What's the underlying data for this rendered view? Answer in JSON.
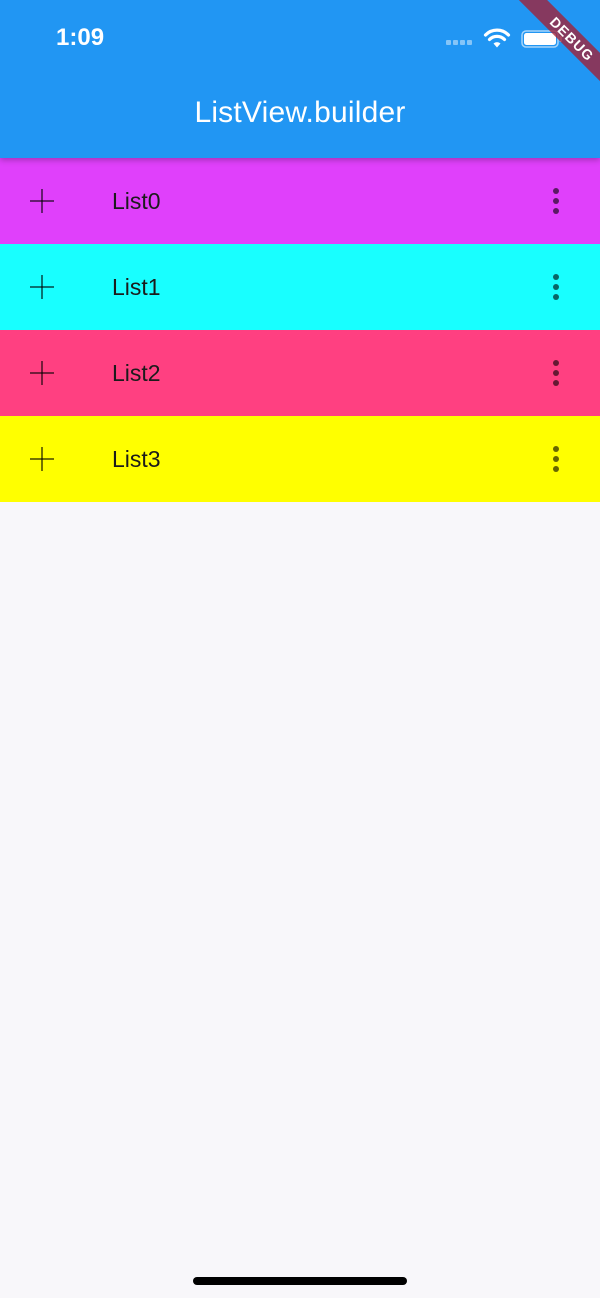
{
  "status_bar": {
    "time": "1:09"
  },
  "debug_banner": {
    "label": "DEBUG"
  },
  "app_bar": {
    "title": "ListView.builder",
    "color": "#2196F3"
  },
  "list": {
    "items": [
      {
        "label": "List0",
        "color": "#E040FB",
        "leading_icon": "add-icon",
        "trailing_icon": "more-vert-icon"
      },
      {
        "label": "List1",
        "color": "#18FFFF",
        "leading_icon": "add-icon",
        "trailing_icon": "more-vert-icon"
      },
      {
        "label": "List2",
        "color": "#FF4081",
        "leading_icon": "add-icon",
        "trailing_icon": "more-vert-icon"
      },
      {
        "label": "List3",
        "color": "#FFFF00",
        "leading_icon": "add-icon",
        "trailing_icon": "more-vert-icon"
      }
    ]
  },
  "background_color": "#F8F7FA"
}
